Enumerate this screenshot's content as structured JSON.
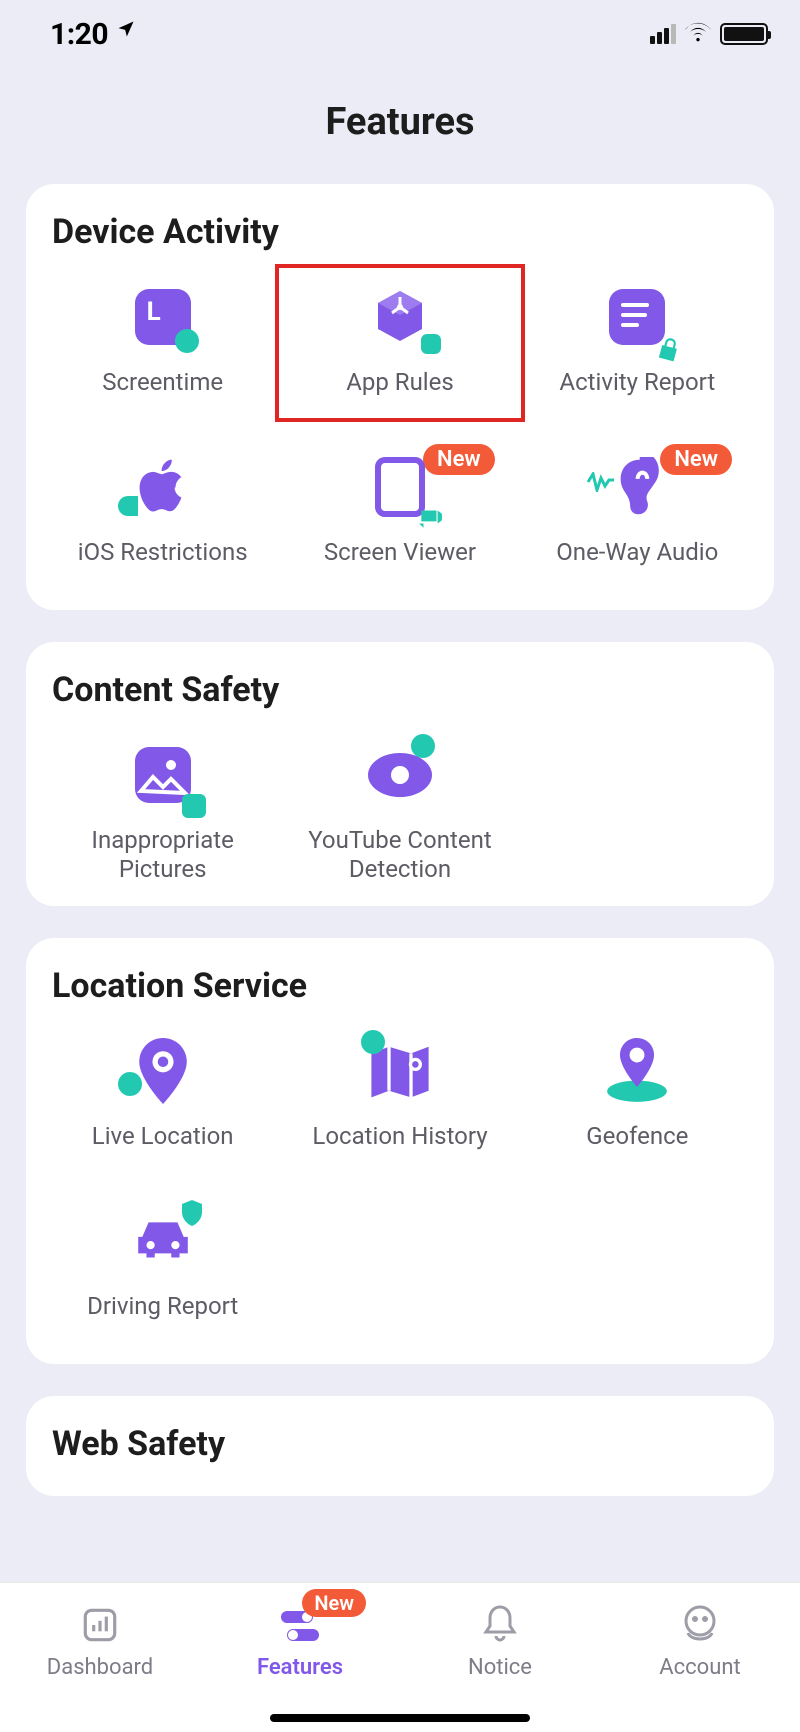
{
  "status": {
    "time": "1:20"
  },
  "title": "Features",
  "badge_new": "New",
  "sections": {
    "device_activity": {
      "title": "Device Activity",
      "items": {
        "screentime": "Screentime",
        "app_rules": "App Rules",
        "activity_report": "Activity Report",
        "ios_restrictions": "iOS Restrictions",
        "screen_viewer": "Screen Viewer",
        "one_way_audio": "One-Way Audio"
      }
    },
    "content_safety": {
      "title": "Content Safety",
      "items": {
        "inappropriate_pictures": "Inappropriate Pictures",
        "youtube_detection": "YouTube Content Detection"
      }
    },
    "location_service": {
      "title": "Location Service",
      "items": {
        "live_location": "Live Location",
        "location_history": "Location History",
        "geofence": "Geofence",
        "driving_report": "Driving Report"
      }
    },
    "web_safety": {
      "title": "Web Safety"
    }
  },
  "tabs": {
    "dashboard": "Dashboard",
    "features": "Features",
    "notice": "Notice",
    "account": "Account"
  }
}
